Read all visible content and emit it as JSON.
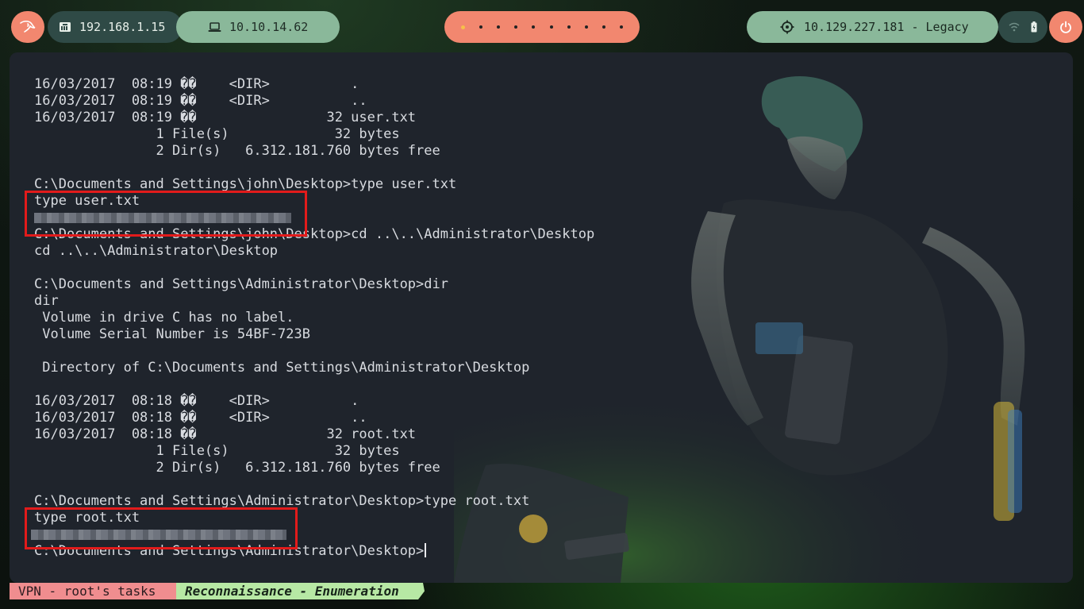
{
  "topbar": {
    "local_ip": "192.168.1.15",
    "vpn_ip": "10.10.14.62",
    "target": "10.129.227.181 - Legacy",
    "workspaces": [
      {
        "active": true
      },
      {
        "active": false
      },
      {
        "active": false
      },
      {
        "active": false
      },
      {
        "active": false
      },
      {
        "active": false
      },
      {
        "active": false
      },
      {
        "active": false
      },
      {
        "active": false
      },
      {
        "active": false
      }
    ],
    "icons": {
      "kali": "kali-dragon-icon",
      "local": "ethernet-icon",
      "vpn": "laptop-icon",
      "target": "crosshair-icon",
      "tray1": "network-icon",
      "tray2": "battery-icon",
      "power": "power-icon"
    }
  },
  "terminal": {
    "lines": [
      "16/03/2017  08:19 ��    <DIR>          .",
      "16/03/2017  08:19 ��    <DIR>          ..",
      "16/03/2017  08:19 ��                32 user.txt",
      "               1 File(s)             32 bytes",
      "               2 Dir(s)   6.312.181.760 bytes free",
      "",
      "C:\\Documents and Settings\\john\\Desktop>type user.txt",
      "type user.txt",
      "",
      "C:\\Documents and Settings\\john\\Desktop>cd ..\\..\\Administrator\\Desktop",
      "cd ..\\..\\Administrator\\Desktop",
      "",
      "C:\\Documents and Settings\\Administrator\\Desktop>dir",
      "dir",
      " Volume in drive C has no label.",
      " Volume Serial Number is 54BF-723B",
      "",
      " Directory of C:\\Documents and Settings\\Administrator\\Desktop",
      "",
      "16/03/2017  08:18 ��    <DIR>          .",
      "16/03/2017  08:18 ��    <DIR>          ..",
      "16/03/2017  08:18 ��                32 root.txt",
      "               1 File(s)             32 bytes",
      "               2 Dir(s)   6.312.181.760 bytes free",
      "",
      "C:\\Documents and Settings\\Administrator\\Desktop>type root.txt",
      "type root.txt",
      "",
      "C:\\Documents and Settings\\Administrator\\Desktop>"
    ],
    "redacted_line_indices": [
      8,
      27
    ]
  },
  "statusbar": {
    "session": "VPN - root's tasks",
    "window": "Reconnaissance - Enumeration"
  },
  "colors": {
    "accent_salmon": "#f2876f",
    "accent_green": "#8ab89a",
    "dark_teal": "#2f4a46",
    "highlight_red": "#e21b1b",
    "terminal_bg": "#1f242c",
    "tmux_pink": "#f08d8f",
    "tmux_green": "#b7e8a4"
  }
}
